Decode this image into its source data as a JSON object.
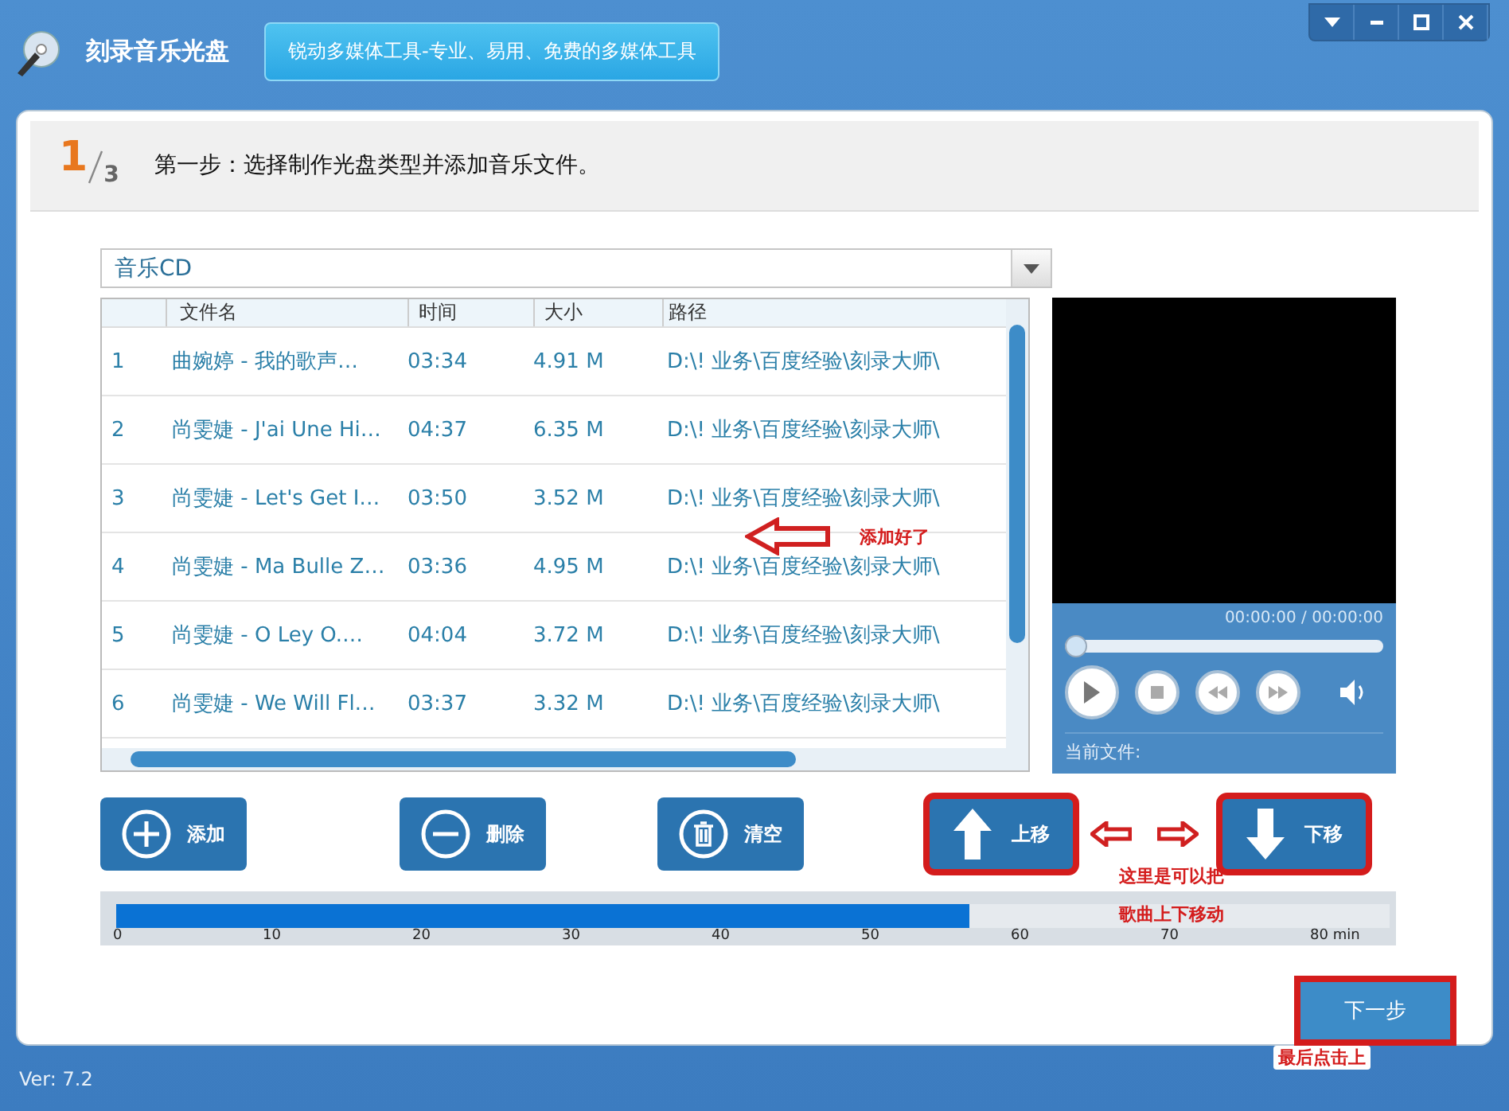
{
  "window": {
    "title": "刻录音乐光盘",
    "tagline": "锐动多媒体工具-专业、易用、免费的多媒体工具"
  },
  "window_controls": [
    {
      "kind": "menu"
    },
    {
      "kind": "minimize"
    },
    {
      "kind": "maximize"
    },
    {
      "kind": "close"
    }
  ],
  "step": {
    "current": "1",
    "total": "3",
    "text": "第一步：选择制作光盘类型并添加音乐文件。"
  },
  "disc_type": {
    "value": "音乐CD"
  },
  "table": {
    "columns": [
      "文件名",
      "时间",
      "大小",
      "路径"
    ],
    "rows": [
      {
        "index": "1",
        "name": "曲婉婷 - 我的歌声…",
        "time": "03:34",
        "size": "4.91 M",
        "path": "D:\\! 业务\\百度经验\\刻录大师\\"
      },
      {
        "index": "2",
        "name": "尚雯婕 - J'ai Une Hi…",
        "time": "04:37",
        "size": "6.35 M",
        "path": "D:\\! 业务\\百度经验\\刻录大师\\"
      },
      {
        "index": "3",
        "name": "尚雯婕 - Let's Get I…",
        "time": "03:50",
        "size": "3.52 M",
        "path": "D:\\! 业务\\百度经验\\刻录大师\\"
      },
      {
        "index": "4",
        "name": "尚雯婕 - Ma Bulle Z…",
        "time": "03:36",
        "size": "4.95 M",
        "path": "D:\\! 业务\\百度经验\\刻录大师\\"
      },
      {
        "index": "5",
        "name": "尚雯婕 - O Ley O.…",
        "time": "04:04",
        "size": "3.72 M",
        "path": "D:\\! 业务\\百度经验\\刻录大师\\"
      },
      {
        "index": "6",
        "name": "尚雯婕 - We Will Fl…",
        "time": "03:37",
        "size": "3.32 M",
        "path": "D:\\! 业务\\百度经验\\刻录大师\\"
      }
    ]
  },
  "player": {
    "time": "00:00:00 / 00:00:00",
    "level": 0,
    "current_file_label": "当前文件:"
  },
  "buttons": [
    {
      "kind": "add",
      "label": "添加",
      "annotated": false
    },
    {
      "kind": "delete",
      "label": "删除",
      "annotated": false
    },
    {
      "kind": "clear",
      "label": "清空",
      "annotated": false
    },
    {
      "kind": "up",
      "label": "上移",
      "annotated": true
    },
    {
      "kind": "down",
      "label": "下移",
      "annotated": true
    }
  ],
  "timeline": {
    "level": 0.67,
    "ticks": [
      "0",
      "10",
      "20",
      "30",
      "40",
      "50",
      "60",
      "70",
      "80 min"
    ]
  },
  "next_button": {
    "label": "下一步",
    "annotated": true
  },
  "annotations": {
    "added_note": "添加好了",
    "move_note": [
      "这里是可以把",
      "歌曲上下移动"
    ],
    "final_note": "最后点击上"
  },
  "status_bar": {
    "version": "Ver: 7.2"
  }
}
